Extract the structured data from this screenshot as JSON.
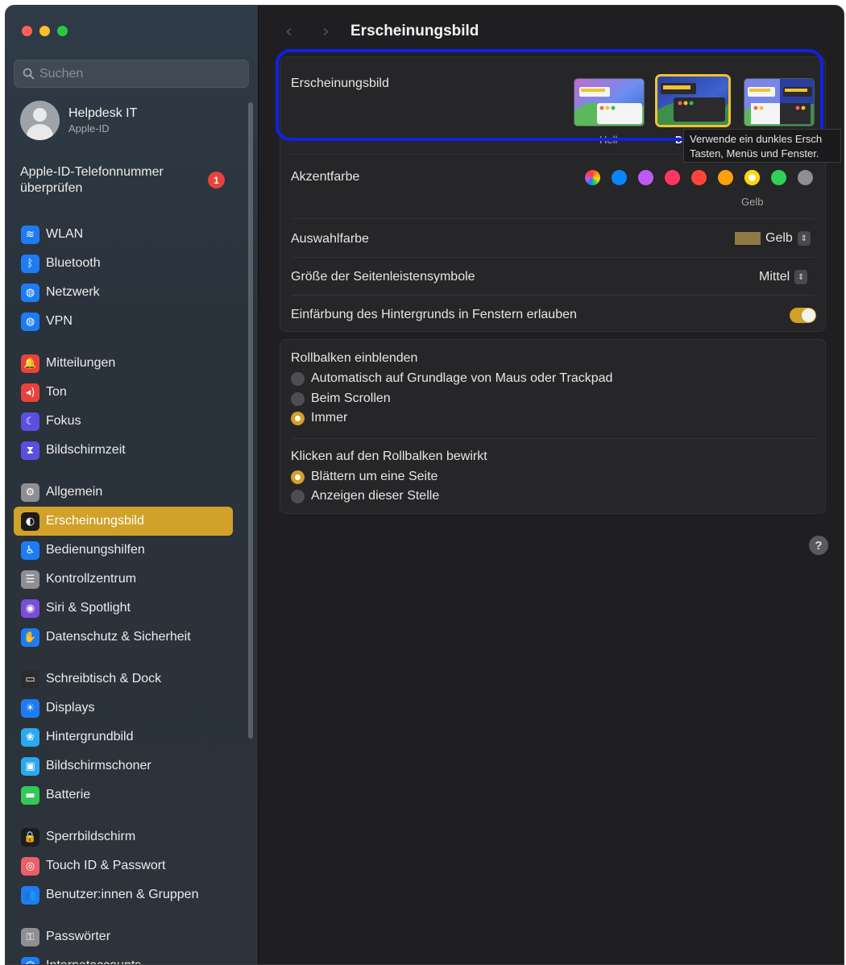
{
  "window": {
    "title": "Ersch​einungsbild"
  },
  "sidebar": {
    "search_placeholder": "Suchen",
    "profile": {
      "name": "Helpdesk IT",
      "sub": "Apple-ID"
    },
    "notice": {
      "text_line1": "Apple-ID-Telefonnummer",
      "text_line2": "überprüfen",
      "badge": "1"
    },
    "groups": [
      [
        {
          "label": "WLAN",
          "icon": "wifi-icon",
          "color": "#1e7cf2",
          "glyph": "≋"
        },
        {
          "label": "Bluetooth",
          "icon": "bluetooth-icon",
          "color": "#1e7cf2",
          "glyph": "ᛒ"
        },
        {
          "label": "Netzwerk",
          "icon": "globe-icon",
          "color": "#1e7cf2",
          "glyph": "◍"
        },
        {
          "label": "VPN",
          "icon": "vpn-globe-icon",
          "color": "#1e7cf2",
          "glyph": "◍"
        }
      ],
      [
        {
          "label": "Mitteilungen",
          "icon": "bell-icon",
          "color": "#e8423c",
          "glyph": "🔔"
        },
        {
          "label": "Ton",
          "icon": "speaker-icon",
          "color": "#e8423c",
          "glyph": "◂)"
        },
        {
          "label": "Fokus",
          "icon": "moon-icon",
          "color": "#5b4fe0",
          "glyph": "☾"
        },
        {
          "label": "Bildschirmzeit",
          "icon": "hourglass-icon",
          "color": "#5b4fe0",
          "glyph": "⧗"
        }
      ],
      [
        {
          "label": "Allgemein",
          "icon": "gear-icon",
          "color": "#8e8e93",
          "glyph": "⚙"
        },
        {
          "label": "Erscheinungsbild",
          "icon": "appearance-icon",
          "color": "#1c1c1e",
          "glyph": "◐",
          "active": true
        },
        {
          "label": "Bedienungshilfen",
          "icon": "accessibility-icon",
          "color": "#1e7cf2",
          "glyph": "♿"
        },
        {
          "label": "Kontrollzentrum",
          "icon": "control-center-icon",
          "color": "#8e8e93",
          "glyph": "☰"
        },
        {
          "label": "Siri & Spotlight",
          "icon": "siri-icon",
          "color": "#7a4fd8",
          "glyph": "◉"
        },
        {
          "label": "Datenschutz & Sicherheit",
          "icon": "hand-icon",
          "color": "#1e7cf2",
          "glyph": "✋"
        }
      ],
      [
        {
          "label": "Schreibtisch & Dock",
          "icon": "dock-icon",
          "color": "#2c2c2e",
          "glyph": "▭"
        },
        {
          "label": "Displays",
          "icon": "sun-icon",
          "color": "#1e7cf2",
          "glyph": "☀"
        },
        {
          "label": "Hintergrundbild",
          "icon": "wallpaper-icon",
          "color": "#2aa9f0",
          "glyph": "❀"
        },
        {
          "label": "Bildschirmschoner",
          "icon": "screensaver-icon",
          "color": "#2aa9f0",
          "glyph": "▣"
        },
        {
          "label": "Batterie",
          "icon": "battery-icon",
          "color": "#34c759",
          "glyph": "▬"
        }
      ],
      [
        {
          "label": "Sperrbildschirm",
          "icon": "lock-icon",
          "color": "#1c1c1e",
          "glyph": "🔒"
        },
        {
          "label": "Touch ID & Passwort",
          "icon": "fingerprint-icon",
          "color": "#e8606a",
          "glyph": "◎"
        },
        {
          "label": "Benutzer:innen & Gruppen",
          "icon": "users-icon",
          "color": "#1e7cf2",
          "glyph": "👥"
        }
      ],
      [
        {
          "label": "Passwörter",
          "icon": "key-icon",
          "color": "#8e8e93",
          "glyph": "⚿"
        },
        {
          "label": "Internetaccounts",
          "icon": "at-icon",
          "color": "#1e7cf2",
          "glyph": "@"
        }
      ]
    ]
  },
  "main": {
    "title": "Erscheinungsbild",
    "appearance": {
      "label": "Erscheinungsbild",
      "options": [
        {
          "label": "Hell"
        },
        {
          "label": "Du"
        },
        {
          "label": ""
        }
      ],
      "selected": "Dunkel"
    },
    "tooltip": {
      "line1": "Verwende ein dunkles Ersch",
      "line2": "Tasten, Menüs und Fenster."
    },
    "accent": {
      "label": "Akzentfarbe",
      "selected_label": "Gelb",
      "colors": [
        "multicolor",
        "#0a84ff",
        "#bf5af2",
        "#ff375f",
        "#ff453a",
        "#ff9f0a",
        "#ffd60a",
        "#30d158",
        "#8e8e93"
      ]
    },
    "highlight": {
      "label": "Auswahlfarbe",
      "value": "Gelb",
      "swatch": "#8e7a44"
    },
    "sidebar_icon_size": {
      "label": "Größe der Seitenleistensymbole",
      "value": "Mittel"
    },
    "tinting": {
      "label": "Einfärbung des Hintergrunds in Fenstern erlauben",
      "on": true
    },
    "scrollbars": {
      "label": "Rollbalken einblenden",
      "options": [
        "Automatisch auf Grundlage von Maus oder Trackpad",
        "Beim Scrollen",
        "Immer"
      ],
      "selected": 2
    },
    "click_scrollbar": {
      "label": "Klicken auf den Rollbalken bewirkt",
      "options": [
        "Blättern um eine Seite",
        "Anzeigen dieser Stelle"
      ],
      "selected": 0
    },
    "help": "?"
  }
}
